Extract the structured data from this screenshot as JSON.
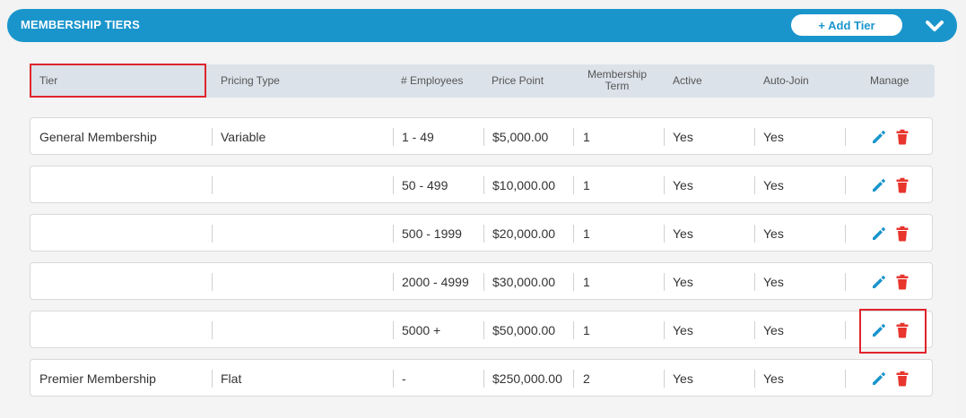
{
  "header": {
    "title": "MEMBERSHIP TIERS",
    "add_button": "+ Add Tier",
    "collapse_icon": "chevron-down-icon"
  },
  "table": {
    "columns": {
      "tier": "Tier",
      "pricing_type": "Pricing Type",
      "employees": "# Employees",
      "price_point": "Price Point",
      "term_line1": "Membership",
      "term_line2": "Term",
      "active": "Active",
      "auto_join": "Auto-Join",
      "manage": "Manage"
    },
    "rows": [
      {
        "tier": "General Membership",
        "pricing_type": "Variable",
        "employees": "1 - 49",
        "price": "$5,000.00",
        "term": "1",
        "active": "Yes",
        "auto_join": "Yes"
      },
      {
        "tier": "",
        "pricing_type": "",
        "employees": "50 - 499",
        "price": "$10,000.00",
        "term": "1",
        "active": "Yes",
        "auto_join": "Yes"
      },
      {
        "tier": "",
        "pricing_type": "",
        "employees": "500 - 1999",
        "price": "$20,000.00",
        "term": "1",
        "active": "Yes",
        "auto_join": "Yes"
      },
      {
        "tier": "",
        "pricing_type": "",
        "employees": "2000 - 4999",
        "price": "$30,000.00",
        "term": "1",
        "active": "Yes",
        "auto_join": "Yes"
      },
      {
        "tier": "",
        "pricing_type": "",
        "employees": "5000 +",
        "price": "$50,000.00",
        "term": "1",
        "active": "Yes",
        "auto_join": "Yes"
      },
      {
        "tier": "Premier Membership",
        "pricing_type": "Flat",
        "employees": "-",
        "price": "$250,000.00",
        "term": "2",
        "active": "Yes",
        "auto_join": "Yes"
      }
    ],
    "icons": {
      "edit": "pencil-icon",
      "delete": "trash-icon"
    }
  },
  "colors": {
    "header_bg": "#1a95cc",
    "table_header_bg": "#dbe2ea",
    "edit_icon": "#1a95cc",
    "delete_icon": "#e8352e",
    "highlight": "#e0242c"
  }
}
